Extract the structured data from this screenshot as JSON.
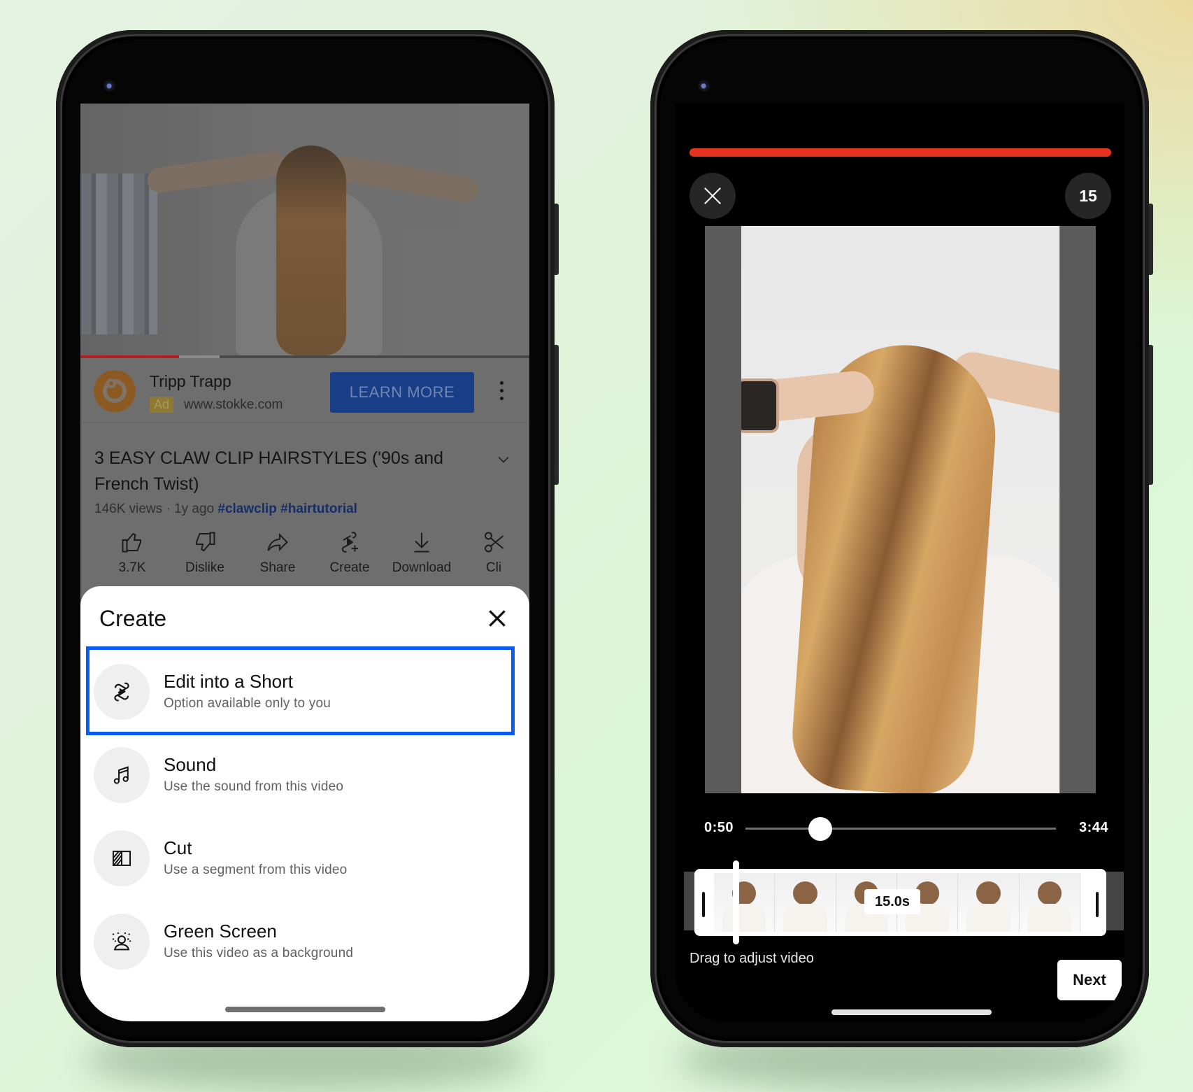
{
  "left_phone": {
    "video": {
      "progress_played": 0.22,
      "progress_buffered": 0.31
    },
    "ad": {
      "advertiser": "Tripp Trapp",
      "badge": "Ad",
      "url": "www.stokke.com",
      "cta": "LEARN MORE",
      "more_icon": "kebab-menu-icon"
    },
    "video_title": "3 EASY CLAW CLIP HAIRSTYLES ('90s and French Twist)",
    "meta": {
      "views": "146K views · 1y ago",
      "hashtags": [
        "#clawclip",
        "#hairtutorial"
      ]
    },
    "actions": [
      {
        "icon": "thumbs-up-icon",
        "label": "3.7K"
      },
      {
        "icon": "thumbs-down-icon",
        "label": "Dislike"
      },
      {
        "icon": "share-icon",
        "label": "Share"
      },
      {
        "icon": "create-icon",
        "label": "Create"
      },
      {
        "icon": "download-icon",
        "label": "Download"
      },
      {
        "icon": "clip-icon",
        "label": "Cli"
      }
    ],
    "sheet": {
      "title": "Create",
      "close_icon": "close-icon",
      "items": [
        {
          "icon": "shorts-icon",
          "label": "Edit into a Short",
          "sub": "Option available only to you",
          "highlighted": true
        },
        {
          "icon": "music-note-icon",
          "label": "Sound",
          "sub": "Use the sound from this video"
        },
        {
          "icon": "cut-icon",
          "label": "Cut",
          "sub": "Use a segment from this video"
        },
        {
          "icon": "green-screen-icon",
          "label": "Green Screen",
          "sub": "Use this video as a background"
        }
      ]
    }
  },
  "right_phone": {
    "recording_progress": 1.0,
    "close_icon": "close-icon",
    "duration_badge": "15",
    "scrubber": {
      "start": "0:50",
      "end": "3:44",
      "position": 0.24
    },
    "segment_duration": "15.0s",
    "hint": "Drag to adjust video",
    "next_label": "Next"
  },
  "colors": {
    "accent_red": "#e7321f",
    "highlight_blue": "#0b5bf0",
    "ad_cta": "#173e86"
  }
}
